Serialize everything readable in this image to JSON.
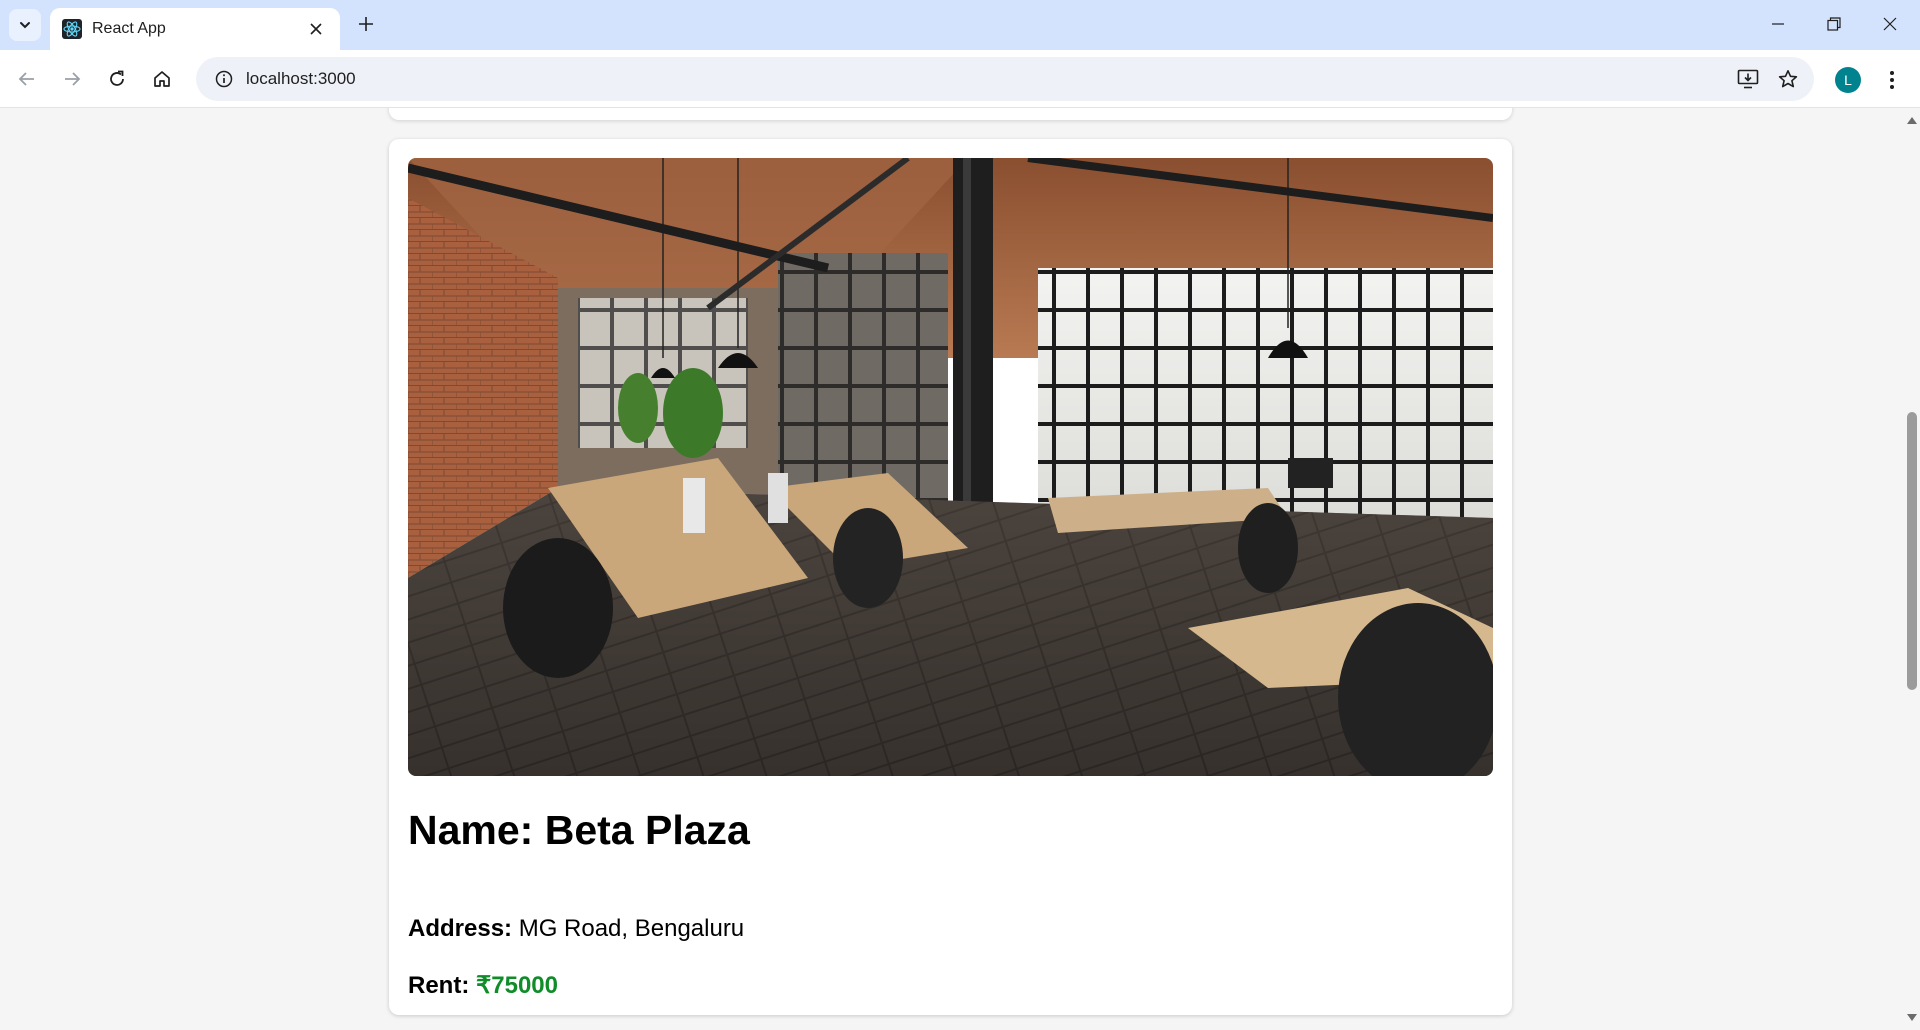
{
  "browser": {
    "tab_title": "React App",
    "url": "localhost:3000",
    "profile_initial": "L",
    "icons": {
      "tab_search": "chevron-down-icon",
      "favicon": "react-icon",
      "tab_close": "close-icon",
      "new_tab": "plus-icon",
      "minimize": "minimize-icon",
      "restore": "restore-icon",
      "close_window": "close-icon",
      "back": "arrow-left-icon",
      "forward": "arrow-right-icon",
      "reload": "reload-icon",
      "home": "home-icon",
      "site_info": "info-icon",
      "install": "install-icon",
      "bookmark": "star-icon",
      "menu": "kebab-menu-icon"
    }
  },
  "listing": {
    "name_label": "Name: Beta Plaza",
    "address_label": "Address:",
    "address_value": " MG Road, Bengaluru",
    "rent_label": "Rent:",
    "rent_value": " ₹75000",
    "image": "industrial loft office interior photo"
  },
  "colors": {
    "price": "#118c2a",
    "tabstrip": "#d3e3fd",
    "avatar": "#00838f"
  }
}
